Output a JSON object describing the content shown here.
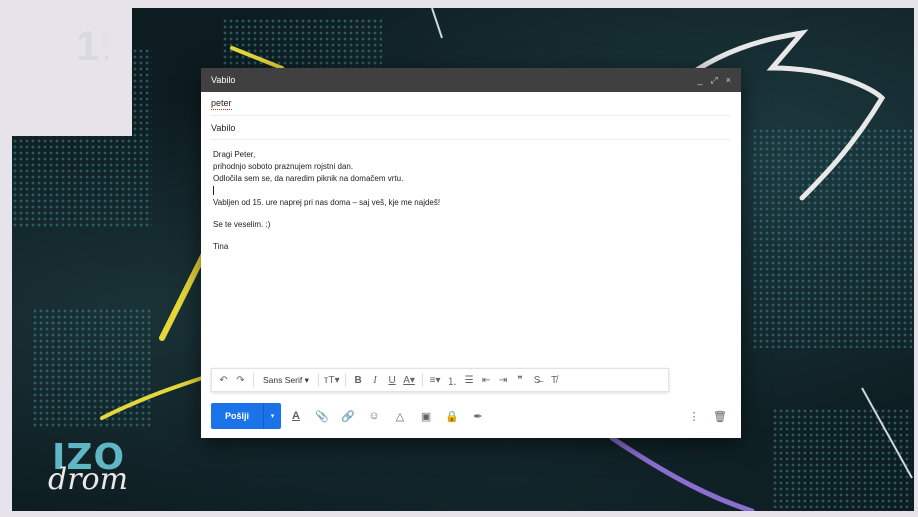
{
  "channel": {
    "number": "1",
    "live_label": "■ ŽIVO"
  },
  "show": {
    "logo_top": "IZO",
    "logo_bottom": "drom"
  },
  "compose": {
    "window_title": "Vabilo",
    "window_controls": {
      "minimize": "_",
      "fullscreen": "⤢",
      "close": "×"
    },
    "to_value": "peter",
    "subject_value": "Vabilo",
    "body_lines": [
      "Dragi Peter,",
      "prihodnjo soboto praznujem rojstni dan.",
      "Odločila sem se, da naredim piknik na domačem vrtu.",
      "",
      "Vabljen od 15. ure naprej pri nas doma – saj veš, kje me najdeš!",
      "",
      "Se te veselim. :)",
      "",
      "Tina"
    ]
  },
  "formatting_toolbar": {
    "undo_icon": "↶",
    "redo_icon": "↷",
    "font_family": "Sans Serif",
    "font_dropdown_icon": "▾",
    "text_size_icon": "тT▾",
    "bold": "B",
    "italic": "I",
    "underline": "U",
    "text_color_icon": "A▾",
    "align_icon": "≡▾",
    "numbered_list_icon": "⒈",
    "bulleted_list_icon": "☰",
    "indent_less_icon": "⇤",
    "indent_more_icon": "⇥",
    "quote_icon": "❞",
    "strikethrough_icon": "S̶",
    "clear_formatting_icon": "T̸"
  },
  "action_bar": {
    "send_label": "Pošlji",
    "send_options_icon": "▾",
    "formatting_toggle_icon": "A",
    "attach_icon": "📎",
    "link_icon": "🔗",
    "emoji_icon": "☺",
    "drive_icon": "△",
    "photo_icon": "▣",
    "lock_icon": "🔒",
    "signature_icon": "✒",
    "more_options_icon": "⋮",
    "discard_icon": "🗑"
  },
  "colors": {
    "send_button": "#1a73e8",
    "titlebar": "#404040",
    "accent_yellow": "#e6d83a",
    "accent_purple": "#8a6fd0"
  }
}
